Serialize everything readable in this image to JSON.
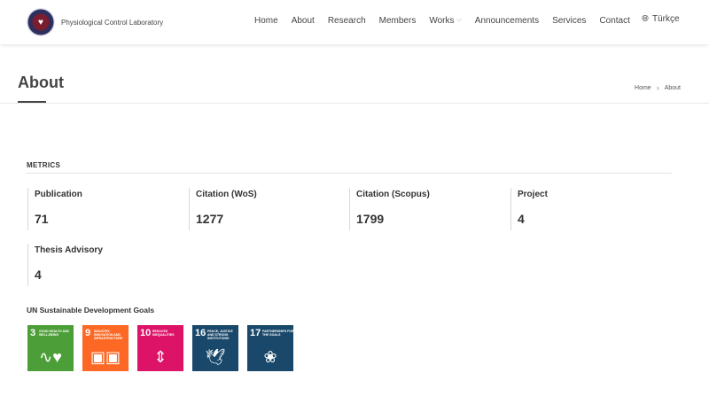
{
  "header": {
    "brand_name": "Physiological Control Laboratory",
    "nav": [
      {
        "label": "Home"
      },
      {
        "label": "About"
      },
      {
        "label": "Research"
      },
      {
        "label": "Members"
      },
      {
        "label": "Works"
      },
      {
        "label": "Announcements"
      },
      {
        "label": "Services"
      },
      {
        "label": "Contact"
      }
    ],
    "language": "Türkçe"
  },
  "page": {
    "title": "About",
    "breadcrumb": [
      "Home",
      "About"
    ]
  },
  "metrics": {
    "heading": "METRICS",
    "items": [
      {
        "label": "Publication",
        "value": "71"
      },
      {
        "label": "Citation (WoS)",
        "value": "1277"
      },
      {
        "label": "Citation (Scopus)",
        "value": "1799"
      },
      {
        "label": "Project",
        "value": "4"
      },
      {
        "label": "Thesis Advisory",
        "value": "4"
      }
    ]
  },
  "sdg": {
    "heading": "UN Sustainable Development Goals",
    "goals": [
      {
        "number": "3",
        "text": "Good Health and Well-Being",
        "color": "#4c9f38",
        "icon": "heartbeat-icon"
      },
      {
        "number": "9",
        "text": "Industry, Innovation and Infrastructure",
        "color": "#fd6925",
        "icon": "cubes-icon"
      },
      {
        "number": "10",
        "text": "Reduced Inequalities",
        "color": "#dd1367",
        "icon": "equality-icon"
      },
      {
        "number": "16",
        "text": "Peace, Justice and Strong Institutions",
        "color": "#19486a",
        "icon": "dove-icon"
      },
      {
        "number": "17",
        "text": "Partnerships for the Goals",
        "color": "#19486a",
        "icon": "rings-icon"
      }
    ]
  }
}
